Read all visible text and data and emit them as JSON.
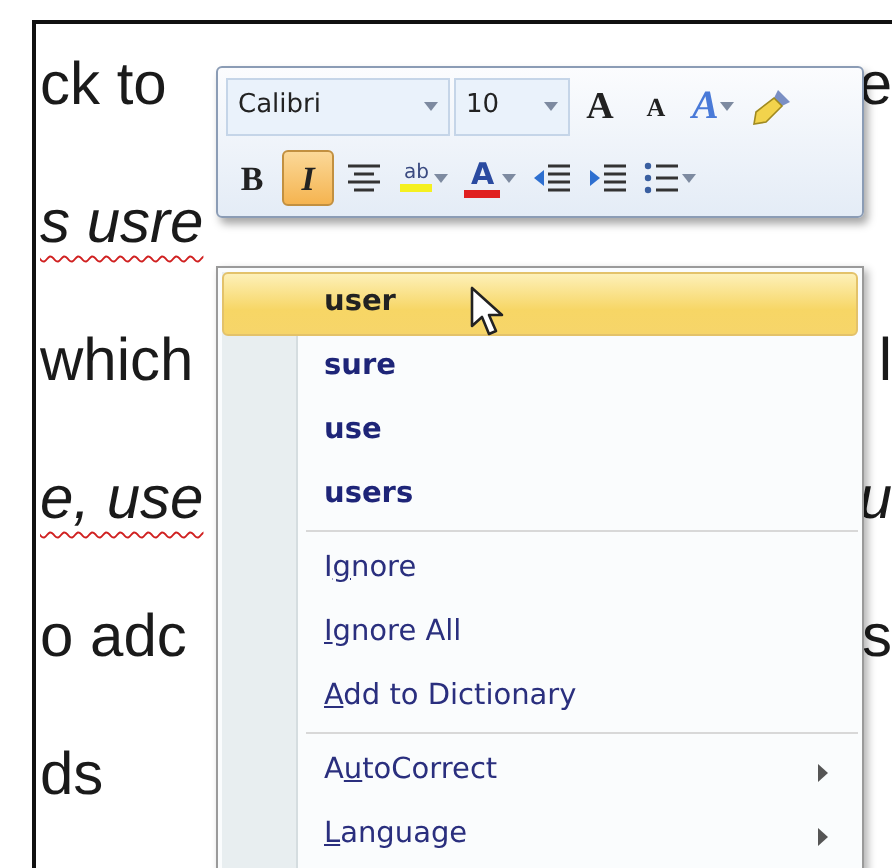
{
  "document": {
    "lines": [
      {
        "left": "ck to",
        "right": "e",
        "italic": false,
        "misspelled": false
      },
      {
        "left": "s usre",
        "italic": true,
        "misspelled": true
      },
      {
        "left": "which",
        "right": "l",
        "italic": false,
        "misspelled": false
      },
      {
        "left": "e, use",
        "right": "u",
        "italic": true,
        "misspelled": true
      },
      {
        "left": "o adc",
        "right": "s",
        "italic": false,
        "misspelled": false
      },
      {
        "left": "ds",
        "italic": false,
        "misspelled": false
      }
    ]
  },
  "mini_toolbar": {
    "font": "Calibri",
    "size": "10",
    "row1": [
      {
        "kind": "grow-font",
        "glyph": "A"
      },
      {
        "kind": "shrink-font",
        "glyph": "A"
      },
      {
        "kind": "text-effects",
        "glyph": "A"
      },
      {
        "kind": "format-painter"
      }
    ],
    "row2": [
      {
        "kind": "bold",
        "glyph": "B",
        "selected": false
      },
      {
        "kind": "italic",
        "glyph": "I",
        "selected": true
      },
      {
        "kind": "center"
      },
      {
        "kind": "highlight",
        "glyph": "ab"
      },
      {
        "kind": "font-color",
        "glyph": "A"
      },
      {
        "kind": "outdent"
      },
      {
        "kind": "indent"
      },
      {
        "kind": "bullets"
      }
    ]
  },
  "context_menu": {
    "items": [
      {
        "kind": "suggestion",
        "label": "user",
        "hovered": true
      },
      {
        "kind": "suggestion",
        "label": "sure",
        "hovered": false
      },
      {
        "kind": "suggestion",
        "label": "use",
        "hovered": false
      },
      {
        "kind": "suggestion",
        "label": "users",
        "hovered": false
      },
      {
        "kind": "separator"
      },
      {
        "kind": "command",
        "before": "I",
        "key": "g",
        "after": "nore",
        "hovered": false,
        "submenu": false
      },
      {
        "kind": "command",
        "key": "I",
        "after": "gnore All",
        "hovered": false,
        "submenu": false
      },
      {
        "kind": "command",
        "key": "A",
        "after": "dd to Dictionary",
        "hovered": false,
        "submenu": false
      },
      {
        "kind": "separator"
      },
      {
        "kind": "command",
        "before": "A",
        "key": "u",
        "after": "toCorrect",
        "hovered": false,
        "submenu": true
      },
      {
        "kind": "command",
        "key": "L",
        "after": "anguage",
        "hovered": false,
        "submenu": true
      }
    ]
  }
}
